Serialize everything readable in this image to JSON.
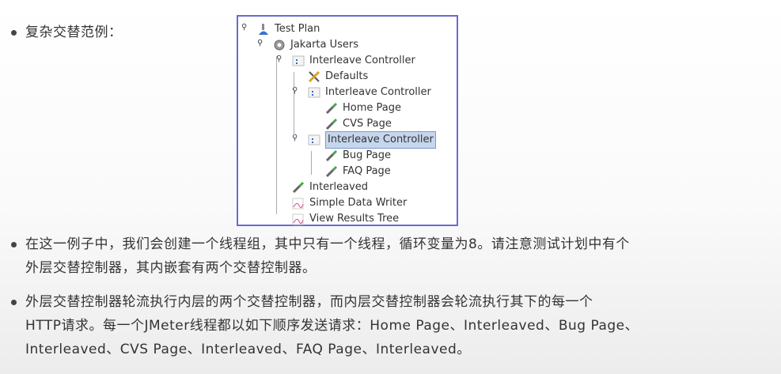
{
  "heading": "复杂交替范例：",
  "tree": [
    {
      "label": "Test Plan",
      "icon": "test-plan-icon",
      "depth": 0
    },
    {
      "label": "Jakarta Users",
      "icon": "thread-group-gear-icon",
      "depth": 1
    },
    {
      "label": "Interleave Controller",
      "icon": "controller-icon",
      "depth": 2
    },
    {
      "label": "Defaults",
      "icon": "config-tools-icon",
      "depth": 3
    },
    {
      "label": "Interleave Controller",
      "icon": "controller-icon",
      "depth": 3
    },
    {
      "label": "Home Page",
      "icon": "sampler-pipette-icon",
      "depth": 4
    },
    {
      "label": "CVS Page",
      "icon": "sampler-pipette-icon",
      "depth": 4
    },
    {
      "label": "Interleave Controller",
      "icon": "controller-icon",
      "depth": 3,
      "selected": true
    },
    {
      "label": "Bug Page",
      "icon": "sampler-pipette-icon",
      "depth": 4
    },
    {
      "label": "FAQ Page",
      "icon": "sampler-pipette-icon",
      "depth": 4
    },
    {
      "label": "Interleaved",
      "icon": "sampler-pipette-icon",
      "depth": 2
    },
    {
      "label": "Simple Data Writer",
      "icon": "listener-graph-icon",
      "depth": 2
    },
    {
      "label": "View Results Tree",
      "icon": "listener-graph-icon",
      "depth": 2
    }
  ],
  "paragraphs": [
    [
      "在这一例子中，我们会创建一个线程组，其中只有一个线程，循环变量为8。请注意测试计划中有个",
      "外层交替控制器，其内嵌套有两个交替控制器。"
    ],
    [
      "外层交替控制器轮流执行内层的两个交替控制器，而内层交替控制器会轮流执行其下的每一个",
      "HTTP请求。每一个JMeter线程都以如下顺序发送请求：Home Page、Interleaved、Bug Page、",
      "Interleaved、CVS Page、Interleaved、FAQ Page、Interleaved。"
    ]
  ]
}
